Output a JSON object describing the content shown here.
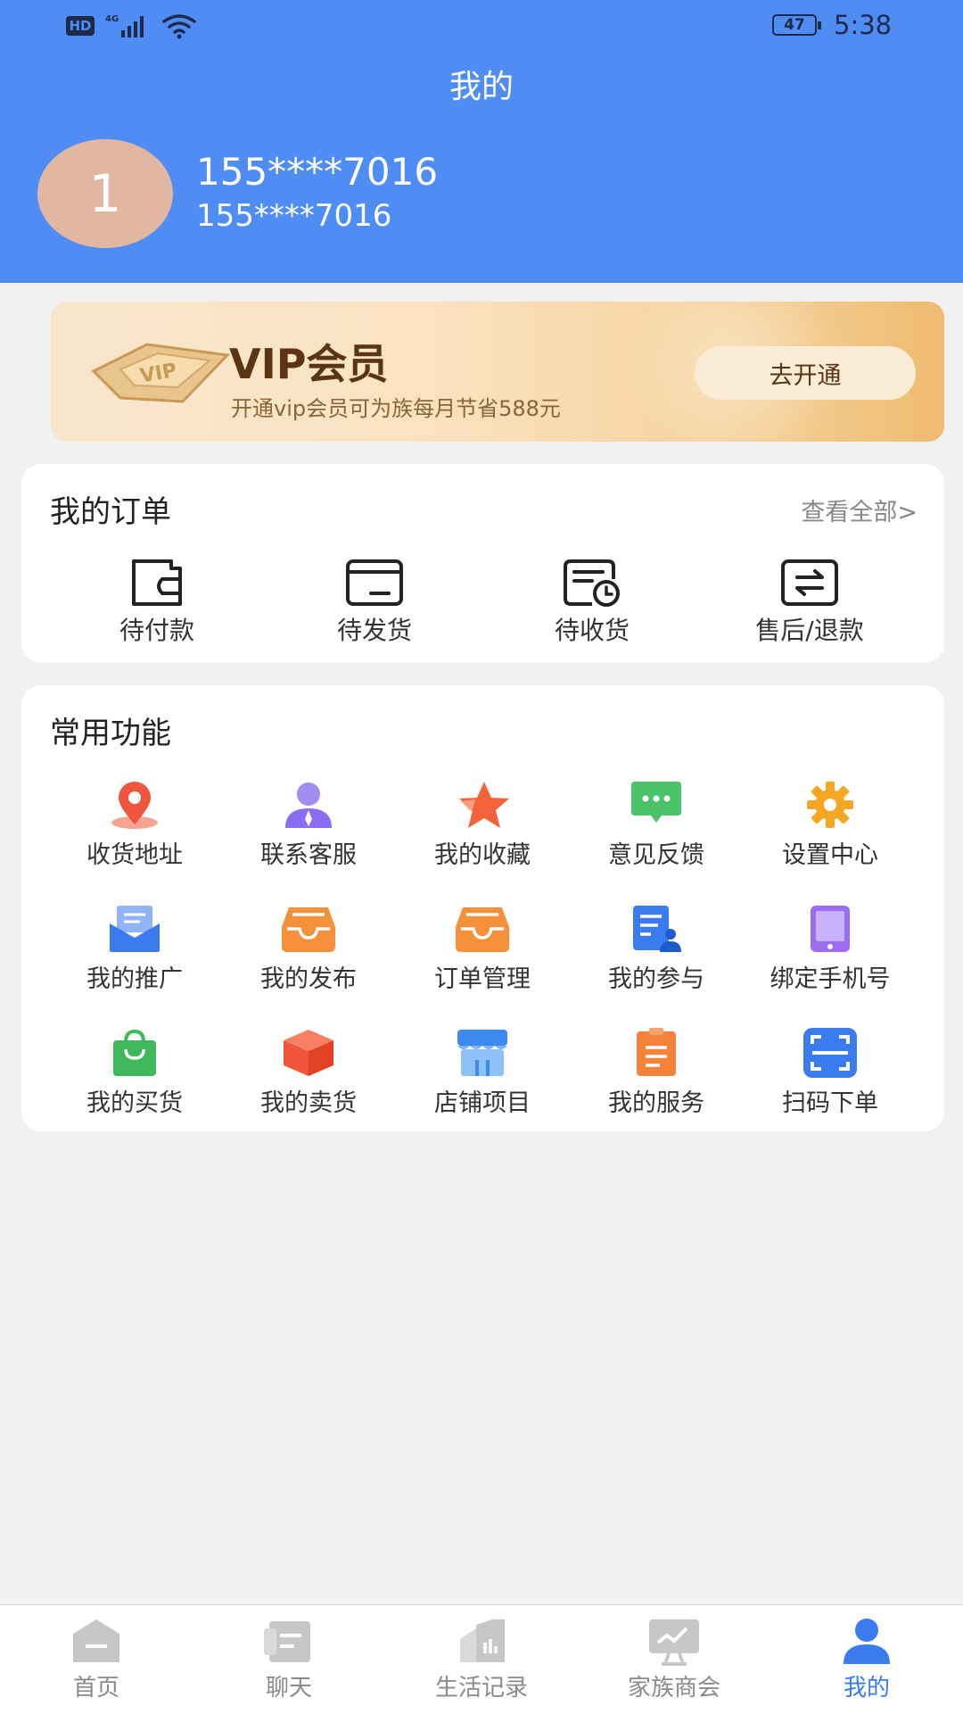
{
  "status_bar": {
    "hd": "HD",
    "network": "4G",
    "battery": "47",
    "time": "5:38"
  },
  "header": {
    "title": "我的",
    "avatar_text": "1",
    "user_name": "155****7016",
    "user_sub": "155****7016"
  },
  "vip": {
    "title": "VIP会员",
    "desc": "开通vip会员可为族每月节省588元",
    "button": "去开通"
  },
  "orders": {
    "title": "我的订单",
    "view_all": "查看全部>",
    "items": [
      {
        "label": "待付款",
        "icon": "wallet-icon"
      },
      {
        "label": "待发货",
        "icon": "box-icon"
      },
      {
        "label": "待收货",
        "icon": "receipt-clock-icon"
      },
      {
        "label": "售后/退款",
        "icon": "exchange-icon"
      }
    ]
  },
  "functions": {
    "title": "常用功能",
    "items": [
      {
        "label": "收货地址",
        "icon": "location-pin-icon",
        "color": "#f0553f"
      },
      {
        "label": "联系客服",
        "icon": "customer-service-icon",
        "color": "#8a6df2"
      },
      {
        "label": "我的收藏",
        "icon": "star-icon",
        "color": "#f2633a"
      },
      {
        "label": "意见反馈",
        "icon": "chat-bubble-icon",
        "color": "#4cc26a"
      },
      {
        "label": "设置中心",
        "icon": "gear-icon",
        "color": "#f5a623"
      },
      {
        "label": "我的推广",
        "icon": "envelope-icon",
        "color": "#3b7bf0"
      },
      {
        "label": "我的发布",
        "icon": "inbox-tray-icon",
        "color": "#f5913a"
      },
      {
        "label": "订单管理",
        "icon": "inbox-tray-icon",
        "color": "#f5913a"
      },
      {
        "label": "我的参与",
        "icon": "document-person-icon",
        "color": "#3b7bf0"
      },
      {
        "label": "绑定手机号",
        "icon": "tablet-icon",
        "color": "#9b6df2"
      },
      {
        "label": "我的买货",
        "icon": "shopping-bag-icon",
        "color": "#3fb85c"
      },
      {
        "label": "我的卖货",
        "icon": "cube-icon",
        "color": "#f2553a"
      },
      {
        "label": "店铺项目",
        "icon": "store-icon",
        "color": "#3b8af0"
      },
      {
        "label": "我的服务",
        "icon": "clipboard-icon",
        "color": "#f5813a"
      },
      {
        "label": "扫码下单",
        "icon": "scan-icon",
        "color": "#3b7bf0"
      }
    ]
  },
  "tabbar": {
    "items": [
      {
        "label": "首页",
        "icon": "home-icon",
        "active": false
      },
      {
        "label": "聊天",
        "icon": "chat-icon",
        "active": false
      },
      {
        "label": "生活记录",
        "icon": "records-icon",
        "active": false
      },
      {
        "label": "家族商会",
        "icon": "chamber-monitor-icon",
        "active": false
      },
      {
        "label": "我的",
        "icon": "user-icon",
        "active": true
      }
    ]
  },
  "colors": {
    "header": "#4f8df5",
    "accent": "#3b7bf0",
    "background": "#f1f1f1"
  }
}
